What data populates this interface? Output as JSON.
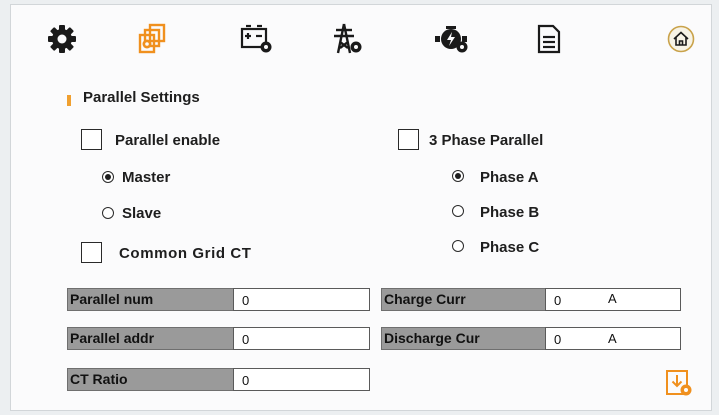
{
  "section_title": "Parallel Settings",
  "options": {
    "parallel_enable": {
      "label": "Parallel enable",
      "checked": false
    },
    "three_phase_parallel": {
      "label": "3 Phase Parallel",
      "checked": false
    },
    "common_grid_ct": {
      "label": "Common Grid CT",
      "checked": false
    }
  },
  "role": {
    "master": {
      "label": "Master",
      "checked": true
    },
    "slave": {
      "label": "Slave",
      "checked": false
    }
  },
  "phase": {
    "a": {
      "label": "Phase A",
      "checked": true
    },
    "b": {
      "label": "Phase B",
      "checked": false
    },
    "c": {
      "label": "Phase C",
      "checked": false
    }
  },
  "fields": {
    "parallel_num": {
      "label": "Parallel num",
      "value": "0"
    },
    "parallel_addr": {
      "label": "Parallel addr",
      "value": "0"
    },
    "ct_ratio": {
      "label": "CT Ratio",
      "value": "0"
    },
    "charge_curr": {
      "label": "Charge Curr",
      "value": "0",
      "unit": "A"
    },
    "discharge_cur": {
      "label": "Discharge Cur",
      "value": "0",
      "unit": "A"
    }
  },
  "colors": {
    "accent": "#f0901e",
    "section_marker": "#f0a030"
  },
  "icons": {
    "tabs": [
      "gear-icon",
      "parallel-settings-icon",
      "battery-settings-icon",
      "grid-settings-icon",
      "generator-settings-icon",
      "document-icon"
    ],
    "home": "home-icon",
    "save": "save-settings-icon"
  }
}
